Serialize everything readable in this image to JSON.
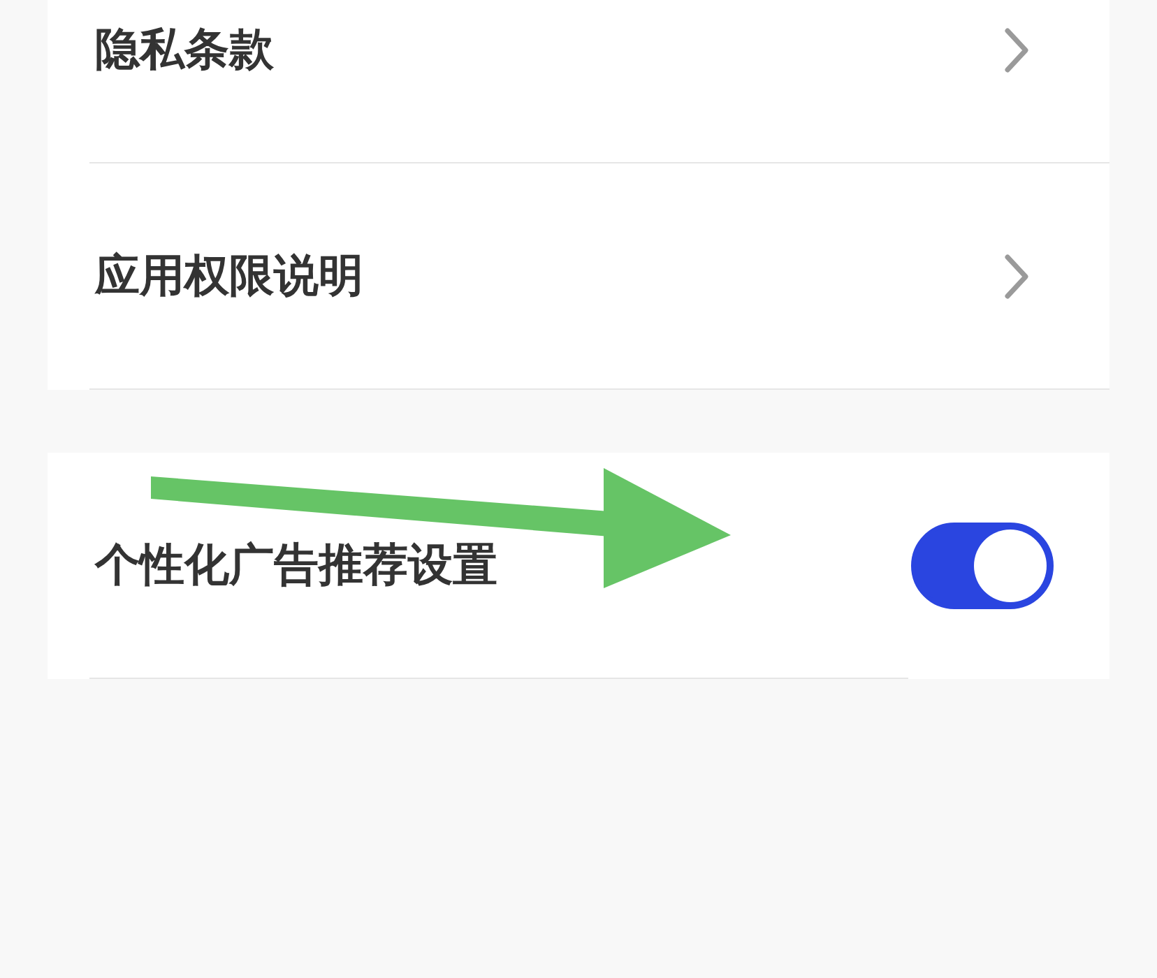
{
  "groups": [
    {
      "items": [
        {
          "label": "隐私条款",
          "kind": "link"
        },
        {
          "label": "应用权限说明",
          "kind": "link"
        }
      ]
    },
    {
      "items": [
        {
          "label": "个性化广告推荐设置",
          "kind": "toggle",
          "on": true
        }
      ]
    }
  ],
  "annotations": [
    {
      "kind": "arrow",
      "color": "#66c466"
    }
  ]
}
